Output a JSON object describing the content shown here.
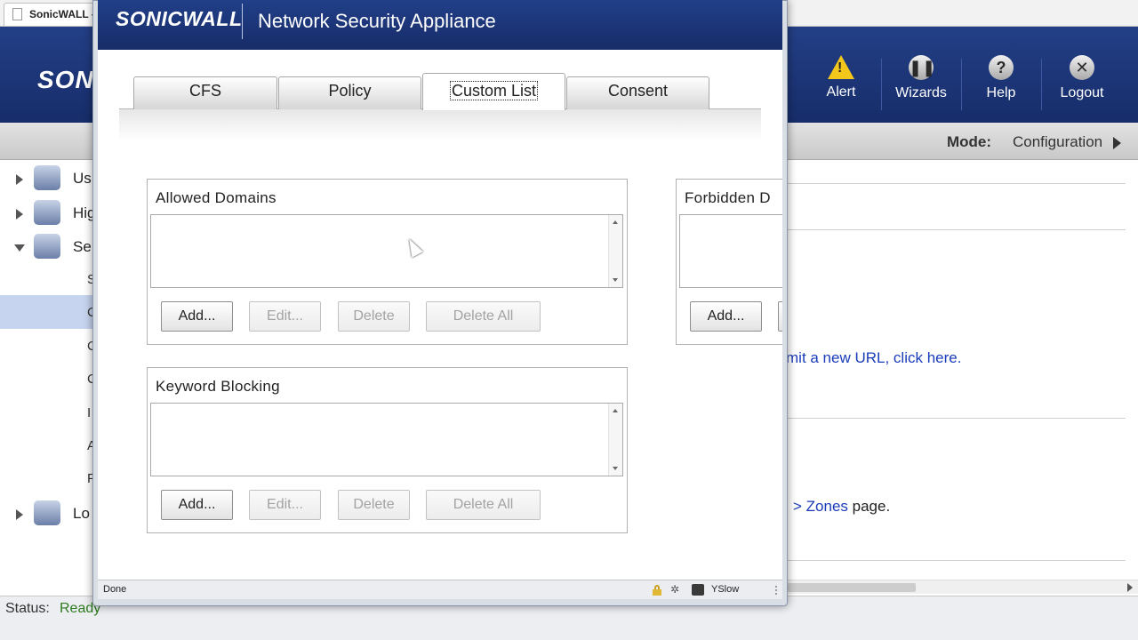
{
  "browser_tab": {
    "label": "SonicWALL -"
  },
  "main_header": {
    "logo": "SONIC",
    "buttons": [
      {
        "label": "Alert",
        "icon": "alert-icon"
      },
      {
        "label": "Wizards",
        "icon": "wizard-icon"
      },
      {
        "label": "Help",
        "icon": "help-icon"
      },
      {
        "label": "Logout",
        "icon": "logout-icon"
      }
    ]
  },
  "mode_bar": {
    "label": "Mode:",
    "value": "Configuration"
  },
  "sidebar": {
    "items": [
      {
        "label": "Us",
        "icon": "users-icon"
      },
      {
        "label": "Hig",
        "icon": "high-availability-icon"
      },
      {
        "label": "Se",
        "icon": "security-shield-icon"
      },
      {
        "label": "Lo",
        "icon": "log-icon"
      }
    ],
    "subitems": [
      "S",
      "C",
      "C",
      "C",
      "I",
      "A",
      "F"
    ]
  },
  "background_content": {
    "text1": "mit a new URL, click here.",
    "text2_prefix": "> ",
    "text2_link": "Zones",
    "text2_suffix": " page."
  },
  "main_status": {
    "label": "Status:",
    "value": "Ready"
  },
  "popup": {
    "logo": "SONICWALL",
    "title": "Network Security Appliance",
    "tabs": [
      {
        "label": "CFS"
      },
      {
        "label": "Policy"
      },
      {
        "label": "Custom List"
      },
      {
        "label": "Consent"
      }
    ],
    "active_tab": "Custom List",
    "panels": {
      "allowed": {
        "title": "Allowed Domains",
        "buttons": {
          "add": "Add...",
          "edit": "Edit...",
          "delete": "Delete",
          "delete_all": "Delete All"
        }
      },
      "forbidden": {
        "title": "Forbidden D",
        "buttons": {
          "add": "Add..."
        }
      },
      "keyword": {
        "title": "Keyword Blocking",
        "buttons": {
          "add": "Add...",
          "edit": "Edit...",
          "delete": "Delete",
          "delete_all": "Delete All"
        }
      }
    },
    "statusbar": {
      "text": "Done",
      "yslow": "YSlow"
    }
  }
}
